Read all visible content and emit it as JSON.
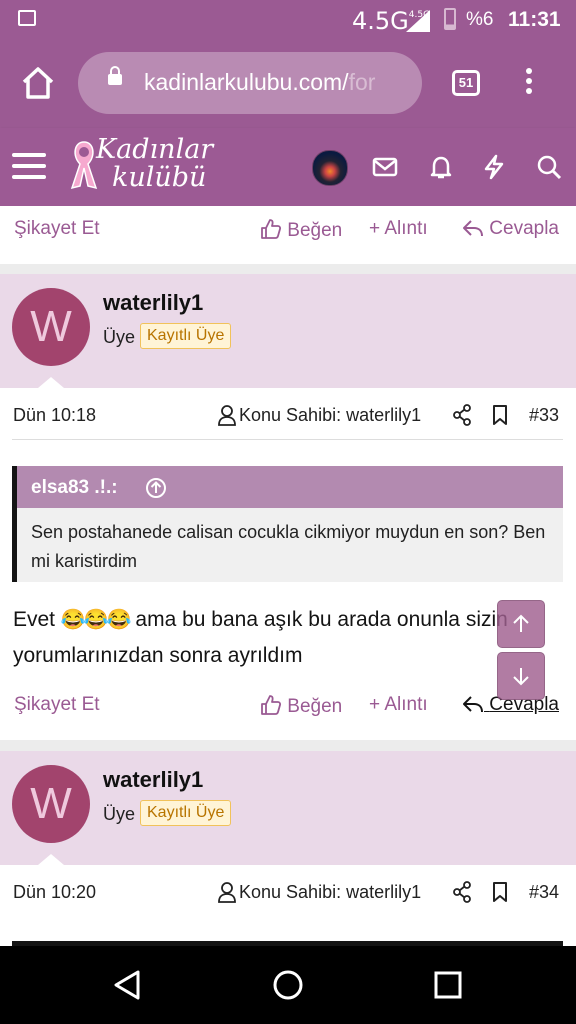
{
  "status_bar": {
    "network": "4.5G",
    "network_small": "4.5G",
    "battery": "%6",
    "time": "11:31"
  },
  "browser": {
    "url_main": "kadinlarkulubu.com/",
    "url_rest": "for",
    "tab_count": "51"
  },
  "site": {
    "logo_line1": "Kadınlar",
    "logo_line2": "kulübü"
  },
  "top_actions": {
    "report": "Şikayet Et",
    "like": "Beğen",
    "quote": "+ Alıntı",
    "reply": "Cevapla"
  },
  "posts": [
    {
      "avatar_letter": "W",
      "username": "waterlily1",
      "role": "Üye",
      "badge": "Kayıtlı Üye",
      "date": "Dün 10:18",
      "owner_label": "Konu Sahibi: waterlily1",
      "number": "#33",
      "quote": {
        "author": "elsa83 .!.:",
        "text": "Sen postahanede calisan cocukla cikmiyor muydun en son? Ben mi karistirdim"
      },
      "body_prefix": "Evet ",
      "emojis": "😂😂😂",
      "body_suffix": " ama bu bana aşık bu arada onunla sizin yorumlarınızdan sonra ayrıldım",
      "actions": {
        "report": "Şikayet Et",
        "like": "Beğen",
        "quote": "+ Alıntı",
        "reply": "Cevapla"
      }
    },
    {
      "avatar_letter": "W",
      "username": "waterlily1",
      "role": "Üye",
      "badge": "Kayıtlı Üye",
      "date": "Dün 10:20",
      "owner_label": "Konu Sahibi: waterlily1",
      "number": "#34"
    }
  ],
  "colors": {
    "brand": "#9b5a93",
    "user_block": "#ead9e8",
    "avatar": "#a2446d",
    "badge_bg": "#fff4d6",
    "badge_text": "#b87400"
  }
}
